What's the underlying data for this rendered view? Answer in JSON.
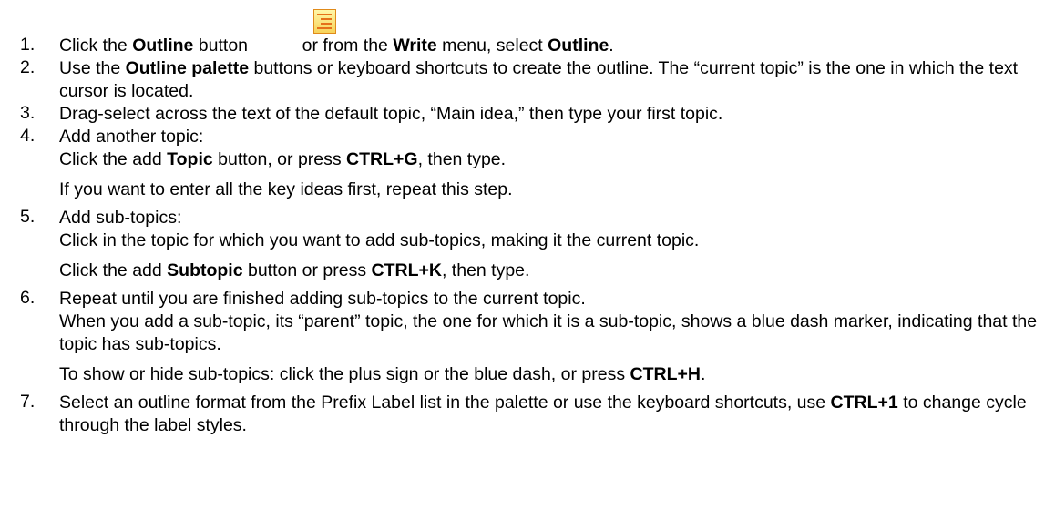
{
  "steps": [
    {
      "num": "1.",
      "parts": [
        {
          "t": "Click the "
        },
        {
          "t": "Outline",
          "b": true
        },
        {
          "t": " button "
        },
        {
          "t": "          "
        },
        {
          "t": "or from the "
        },
        {
          "t": "Write",
          "b": true
        },
        {
          "t": " menu, select "
        },
        {
          "t": "Outline",
          "b": true
        },
        {
          "t": "."
        }
      ]
    },
    {
      "num": "2.",
      "parts": [
        {
          "t": "Use the "
        },
        {
          "t": "Outline palette",
          "b": true
        },
        {
          "t": " buttons or keyboard shortcuts to create the outline. The “current topic” is the one in which the text cursor is located."
        }
      ]
    },
    {
      "num": "3.",
      "parts": [
        {
          "t": "Drag-select across the text of the default topic, “Main idea,” then type your first topic."
        }
      ]
    },
    {
      "num": "4.",
      "parts": [
        {
          "t": "Add another topic:"
        }
      ],
      "paras": [
        [
          {
            "t": "Click the add "
          },
          {
            "t": "Topic",
            "b": true
          },
          {
            "t": " button, or press "
          },
          {
            "t": "CTRL+G",
            "b": true
          },
          {
            "t": ", then type."
          }
        ],
        [
          {
            "t": "If you want to enter all the key ideas first, repeat this step."
          }
        ]
      ]
    },
    {
      "num": "5.",
      "parts": [
        {
          "t": "Add sub-topics:"
        }
      ],
      "paras": [
        [
          {
            "t": "Click in the topic for which you want to add sub-topics, making it the current topic."
          }
        ],
        [
          {
            "t": "Click the add "
          },
          {
            "t": "Subtopic",
            "b": true
          },
          {
            "t": " button or press "
          },
          {
            "t": "CTRL+K",
            "b": true
          },
          {
            "t": ", then type."
          }
        ]
      ]
    },
    {
      "num": "6.",
      "parts": [
        {
          "t": "Repeat until you are finished adding sub-topics to the current topic."
        }
      ],
      "paras": [
        [
          {
            "t": "When you add a sub-topic, its “parent” topic, the one for which it is a sub-topic, shows a blue dash marker, indicating that the topic has sub-topics."
          }
        ],
        [
          {
            "t": "To show or hide sub-topics: click the plus sign or the blue dash, or press "
          },
          {
            "t": "CTRL+H",
            "b": true
          },
          {
            "t": "."
          }
        ]
      ]
    },
    {
      "num": "7.",
      "parts": [
        {
          "t": "Select an outline format from the Prefix Label list in the palette or use the keyboard shortcuts, use "
        },
        {
          "t": "CTRL+1",
          "b": true
        },
        {
          "t": " to change cycle through the label styles."
        }
      ]
    }
  ]
}
